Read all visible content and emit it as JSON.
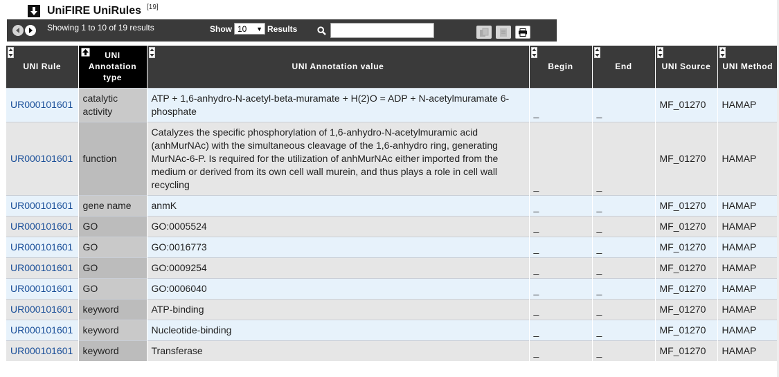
{
  "section": {
    "title": "UniFIRE UniRules",
    "ref": "[19]"
  },
  "toolbar": {
    "results_info": "Showing 1 to 10 of 19 results",
    "show_label": "Show",
    "page_size": "10",
    "results_label": "Results",
    "search_value": ""
  },
  "table": {
    "headers": [
      "UNI Rule",
      "UNI Annotation type",
      "UNI Annotation value",
      "Begin",
      "End",
      "UNI Source",
      "UNI Method"
    ],
    "rows": [
      [
        "UR000101601",
        "catalytic activity",
        "ATP + 1,6-anhydro-N-acetyl-beta-muramate + H(2)O = ADP + N-acetylmuramate 6-phosphate",
        "_",
        "_",
        "MF_01270",
        "HAMAP"
      ],
      [
        "UR000101601",
        "function",
        "Catalyzes the specific phosphorylation of 1,6-anhydro-N-acetylmuramic acid (anhMurNAc) with the simultaneous cleavage of the 1,6-anhydro ring, generating MurNAc-6-P. Is required for the utilization of anhMurNAc either imported from the medium or derived from its own cell wall murein, and thus plays a role in cell wall recycling",
        "_",
        "_",
        "MF_01270",
        "HAMAP"
      ],
      [
        "UR000101601",
        "gene name",
        "anmK",
        "_",
        "_",
        "MF_01270",
        "HAMAP"
      ],
      [
        "UR000101601",
        "GO",
        "GO:0005524",
        "_",
        "_",
        "MF_01270",
        "HAMAP"
      ],
      [
        "UR000101601",
        "GO",
        "GO:0016773",
        "_",
        "_",
        "MF_01270",
        "HAMAP"
      ],
      [
        "UR000101601",
        "GO",
        "GO:0009254",
        "_",
        "_",
        "MF_01270",
        "HAMAP"
      ],
      [
        "UR000101601",
        "GO",
        "GO:0006040",
        "_",
        "_",
        "MF_01270",
        "HAMAP"
      ],
      [
        "UR000101601",
        "keyword",
        "ATP-binding",
        "_",
        "_",
        "MF_01270",
        "HAMAP"
      ],
      [
        "UR000101601",
        "keyword",
        "Nucleotide-binding",
        "_",
        "_",
        "MF_01270",
        "HAMAP"
      ],
      [
        "UR000101601",
        "keyword",
        "Transferase",
        "_",
        "_",
        "MF_01270",
        "HAMAP"
      ]
    ]
  },
  "icons": {
    "collapse": "arrow-down-icon",
    "prev": "prev-page-icon",
    "next": "next-page-icon",
    "search": "search-icon",
    "copy": "copy-icon",
    "export": "export-icon",
    "print": "print-icon",
    "sort": "sort-icon",
    "sorted_asc": "sort-asc-icon"
  },
  "colors": {
    "header_bg": "#3a3a3a",
    "header_sorted_bg": "#000000",
    "row_odd": "#e7f2fb",
    "row_even": "#e6e6e6",
    "link": "#1a4f99"
  }
}
